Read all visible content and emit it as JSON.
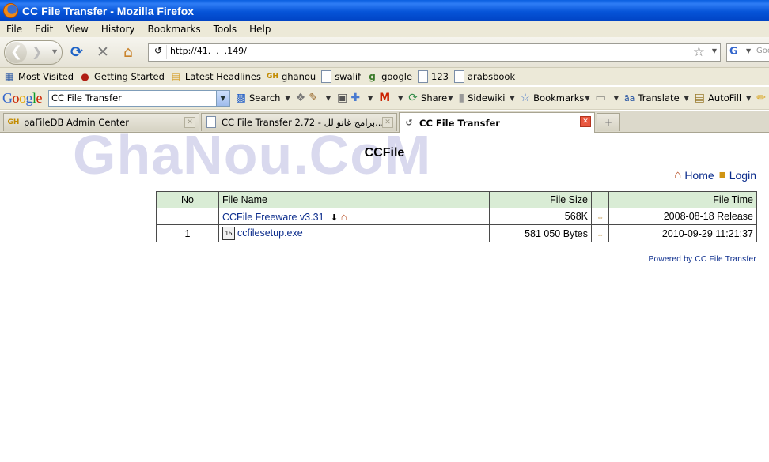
{
  "window": {
    "title": "CC File Transfer - Mozilla Firefox"
  },
  "menu": [
    "File",
    "Edit",
    "View",
    "History",
    "Bookmarks",
    "Tools",
    "Help"
  ],
  "nav": {
    "url": "http://41.  .  .149/",
    "search_placeholder": "Goo"
  },
  "bookmarks": [
    {
      "label": "Most Visited",
      "icon": "most-visited-icon"
    },
    {
      "label": "Getting Started",
      "icon": "getting-started-icon"
    },
    {
      "label": "Latest Headlines",
      "icon": "rss-icon"
    },
    {
      "label": "ghanou",
      "icon": "gh-icon"
    },
    {
      "label": "swalif",
      "icon": "page-icon"
    },
    {
      "label": "google",
      "icon": "google-icon"
    },
    {
      "label": "123",
      "icon": "page-icon"
    },
    {
      "label": "arabsbook",
      "icon": "page-icon"
    }
  ],
  "google_toolbar": {
    "logo": "Google",
    "query": "CC File Transfer",
    "search": "Search",
    "share": "Share",
    "sidewiki": "Sidewiki",
    "bookmarks": "Bookmarks",
    "translate": "Translate",
    "autofill": "AutoFill"
  },
  "tabs": [
    {
      "label": "paFileDB Admin Center",
      "active": false
    },
    {
      "label": "CC File Transfer 2.72 - برامج غانو لل...",
      "active": false
    },
    {
      "label": "CC File Transfer",
      "active": true
    }
  ],
  "page": {
    "watermark": "GhaNou.CoM",
    "title": "CCFile",
    "home": "Home",
    "login": "Login",
    "table": {
      "headers": {
        "no": "No",
        "name": "File Name",
        "size": "File Size",
        "time": "File Time"
      },
      "rows": [
        {
          "no": "",
          "name": "CCFile Freeware v3.31",
          "size": "568K",
          "time": "2008-08-18 Release"
        },
        {
          "no": "1",
          "name": "ccfilesetup.exe",
          "size": "581 050 Bytes",
          "time": "2010-09-29 11:21:37"
        }
      ]
    },
    "powered": "Powered by CC File Transfer"
  }
}
